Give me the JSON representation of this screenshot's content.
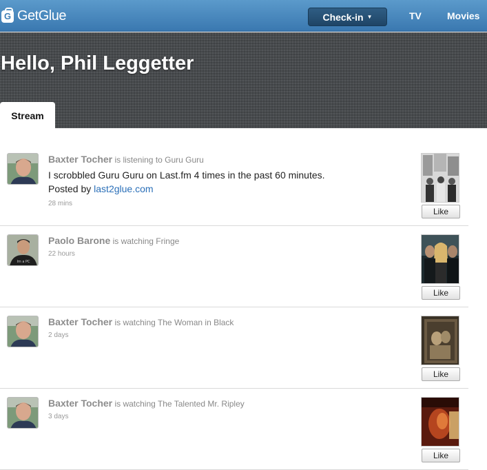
{
  "header": {
    "logo_text": "GetGlue",
    "checkin_label": "Check-in",
    "nav": [
      {
        "label": "TV"
      },
      {
        "label": "Movies"
      }
    ],
    "brand_color": "#3f7fb6"
  },
  "hero": {
    "greeting": "Hello, Phil Leggetter",
    "tabs": [
      {
        "label": "Stream",
        "active": true
      }
    ]
  },
  "stream": {
    "items": [
      {
        "user": "Baxter Tocher",
        "action": "is listening to Guru Guru",
        "message": "I scrobbled Guru Guru on Last.fm 4 times in the past 60 minutes.",
        "posted_by_prefix": "Posted by",
        "posted_by_link": "last2glue.com",
        "time": "28 mins",
        "like_label": "Like"
      },
      {
        "user": "Paolo Barone",
        "action": "is watching Fringe",
        "time": "22 hours",
        "like_label": "Like"
      },
      {
        "user": "Baxter Tocher",
        "action": "is watching The Woman in Black",
        "time": "2 days",
        "like_label": "Like"
      },
      {
        "user": "Baxter Tocher",
        "action": "is watching The Talented Mr. Ripley",
        "time": "3 days",
        "like_label": "Like"
      }
    ]
  }
}
